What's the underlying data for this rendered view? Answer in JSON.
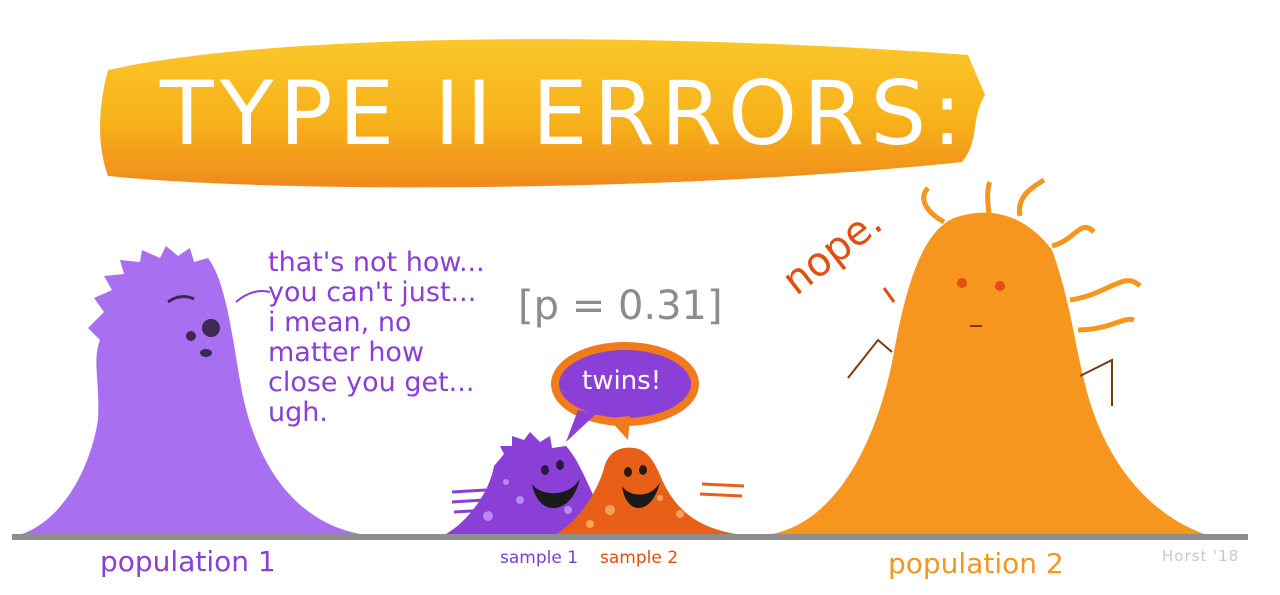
{
  "title": "TYPE II ERRORS:",
  "speech_bubble_lines": [
    "that's not how...",
    "you can't just...",
    "i mean, no",
    "matter how",
    "close you get...",
    "ugh."
  ],
  "p_value_text": "[p = 0.31]",
  "nope_text": "nope.",
  "twins_text": "twins!",
  "labels": {
    "population_1": "population 1",
    "sample_1": "sample 1",
    "sample_2": "sample 2",
    "population_2": "population 2"
  },
  "signature": "Horst '18",
  "colors": {
    "title_stroke": "#f7b21a",
    "title_stroke_dark": "#f08a1c",
    "purple": "#a86ff0",
    "purple_dark": "#8a3fd6",
    "orange": "#f7961f",
    "orange_dark": "#e24e10",
    "baseline": "#8e8e8e",
    "gray_text": "#8c8c8c"
  }
}
